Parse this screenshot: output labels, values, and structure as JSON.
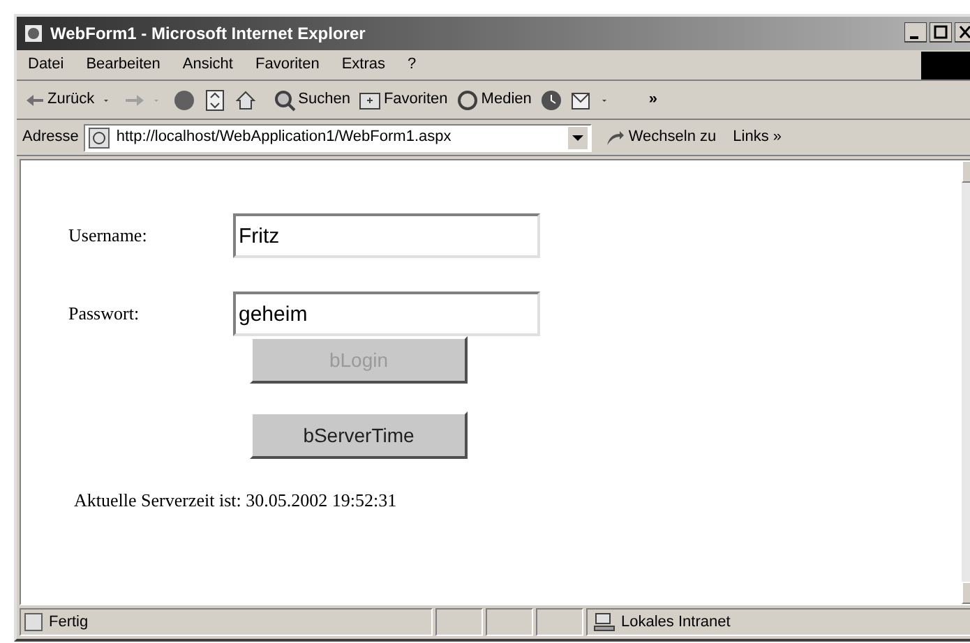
{
  "window": {
    "title": "WebForm1 - Microsoft Internet Explorer"
  },
  "menu": [
    "Datei",
    "Bearbeiten",
    "Ansicht",
    "Favoriten",
    "Extras",
    "?"
  ],
  "toolbar": {
    "back": "Zurück",
    "search": "Suchen",
    "favorites": "Favoriten",
    "media": "Medien",
    "more": "»"
  },
  "address": {
    "label": "Adresse",
    "url": "http://localhost/WebApplication1/WebForm1.aspx",
    "go": "Wechseln zu",
    "links": "Links »"
  },
  "form": {
    "fields": [
      {
        "label": "Username:",
        "value": "Fritz"
      },
      {
        "label": "Passwort:",
        "value": "geheim"
      }
    ],
    "buttons": [
      {
        "label": "bLogin",
        "disabled": true
      },
      {
        "label": "bServerTime",
        "disabled": false
      }
    ],
    "result": "Aktuelle Serverzeit ist: 30.05.2002 19:52:31"
  },
  "status_bar": {
    "text": "Fertig",
    "zone": "Lokales Intranet"
  }
}
